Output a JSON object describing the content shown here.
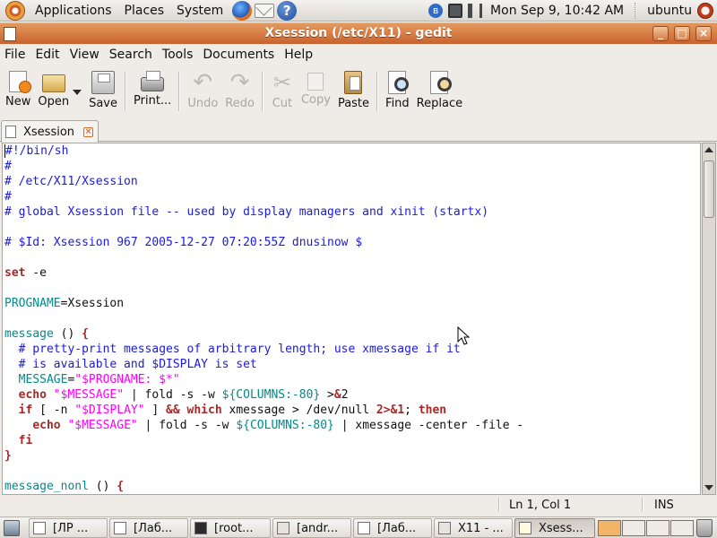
{
  "top_panel": {
    "menus": [
      "Applications",
      "Places",
      "System"
    ],
    "launchers": [
      "firefox-icon",
      "mail-icon",
      "help-icon"
    ],
    "clock": "Mon Sep  9, 10:42 AM",
    "user": "ubuntu"
  },
  "window": {
    "title": "Xsession (/etc/X11) - gedit",
    "accent_color": "#d8733c"
  },
  "menubar": [
    "File",
    "Edit",
    "View",
    "Search",
    "Tools",
    "Documents",
    "Help"
  ],
  "toolbar": {
    "new": "New",
    "open": "Open",
    "save": "Save",
    "print": "Print...",
    "undo": "Undo",
    "redo": "Redo",
    "cut": "Cut",
    "copy": "Copy",
    "paste": "Paste",
    "find": "Find",
    "replace": "Replace"
  },
  "tab": {
    "label": "Xsession"
  },
  "code_lines": [
    [
      [
        "c",
        "#!/bin/sh"
      ]
    ],
    [
      [
        "c",
        "#"
      ]
    ],
    [
      [
        "c",
        "# /etc/X11/Xsession"
      ]
    ],
    [
      [
        "c",
        "#"
      ]
    ],
    [
      [
        "c",
        "# global Xsession file -- used by display managers and xinit (startx)"
      ]
    ],
    [],
    [
      [
        "c",
        "# $Id: Xsession 967 2005-12-27 07:20:55Z dnusinow $"
      ]
    ],
    [],
    [
      [
        "k",
        "set"
      ],
      [
        "",
        " -e"
      ]
    ],
    [],
    [
      [
        "v",
        "PROGNAME"
      ],
      [
        "",
        "=Xsession"
      ]
    ],
    [],
    [
      [
        "v",
        "message"
      ],
      [
        "",
        " () "
      ],
      [
        "k",
        "{"
      ]
    ],
    [
      [
        "",
        "  "
      ],
      [
        "c",
        "# pretty-print messages of arbitrary length; use xmessage if it"
      ]
    ],
    [
      [
        "",
        "  "
      ],
      [
        "c",
        "# is available and $DISPLAY is set"
      ]
    ],
    [
      [
        "",
        "  "
      ],
      [
        "v",
        "MESSAGE"
      ],
      [
        "",
        "="
      ],
      [
        "s",
        "\"$PROGNAME: $*\""
      ]
    ],
    [
      [
        "",
        "  "
      ],
      [
        "k",
        "echo"
      ],
      [
        "",
        " "
      ],
      [
        "s",
        "\"$MESSAGE\""
      ],
      [
        "",
        " | fold -s -w "
      ],
      [
        "v",
        "${COLUMNS:-80}"
      ],
      [
        "",
        " >"
      ],
      [
        "k",
        "&"
      ],
      [
        "",
        "2"
      ]
    ],
    [
      [
        "",
        "  "
      ],
      [
        "k",
        "if"
      ],
      [
        "",
        " [ -n "
      ],
      [
        "s",
        "\"$DISPLAY\""
      ],
      [
        "",
        " ] "
      ],
      [
        "k",
        "&&"
      ],
      [
        "",
        " "
      ],
      [
        "k",
        "which"
      ],
      [
        "",
        " xmessage > /dev/null "
      ],
      [
        "k",
        "2>&1"
      ],
      [
        "",
        "; "
      ],
      [
        "k",
        "then"
      ]
    ],
    [
      [
        "",
        "    "
      ],
      [
        "k",
        "echo"
      ],
      [
        "",
        " "
      ],
      [
        "s",
        "\"$MESSAGE\""
      ],
      [
        "",
        " | fold -s -w "
      ],
      [
        "v",
        "${COLUMNS:-80}"
      ],
      [
        "",
        " | xmessage -center -file -"
      ]
    ],
    [
      [
        "",
        "  "
      ],
      [
        "k",
        "fi"
      ]
    ],
    [
      [
        "k",
        "}"
      ]
    ],
    [],
    [
      [
        "v",
        "message_nonl"
      ],
      [
        "",
        " () "
      ],
      [
        "k",
        "{"
      ]
    ]
  ],
  "statusbar": {
    "position": "Ln 1, Col 1",
    "mode": "INS"
  },
  "taskbar": {
    "tasks": [
      {
        "label": "[ЛР ...",
        "icon": "document-icon",
        "active": false
      },
      {
        "label": "[Лаб...",
        "icon": "document-icon",
        "active": false
      },
      {
        "label": "[root...",
        "icon": "terminal-icon",
        "active": false
      },
      {
        "label": "[andr...",
        "icon": "folder-icon",
        "active": false
      },
      {
        "label": "[Лаб...",
        "icon": "document-icon",
        "active": false
      },
      {
        "label": "X11 - ...",
        "icon": "folder-icon",
        "active": false
      },
      {
        "label": "Xsess...",
        "icon": "text-editor-icon",
        "active": true
      }
    ]
  }
}
